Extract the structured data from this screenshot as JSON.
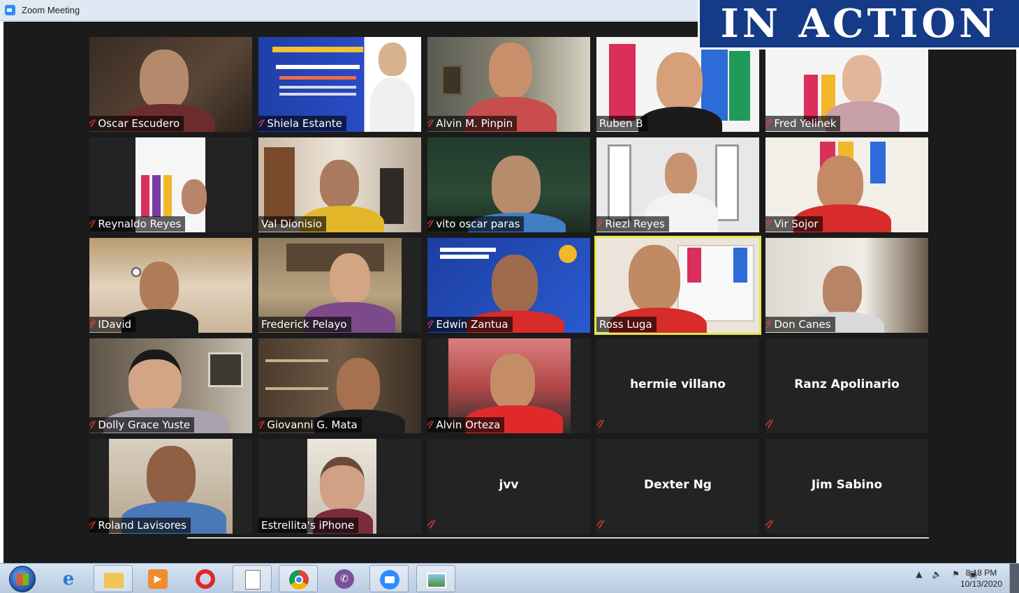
{
  "window": {
    "title": "Zoom Meeting"
  },
  "banner": {
    "text": "IN ACTION"
  },
  "participants": [
    "Oscar Escudero",
    "Shiela Estante",
    "Alvin M. Pinpin",
    "Ruben B",
    "Fred Yelinek",
    "Reynaldo Reyes",
    "Val Dionisio",
    "vito oscar paras",
    "Riezl Reyes",
    "Vir Sojor",
    "IDavid",
    "Frederick Pelayo",
    "Edwin Zantua",
    "Ross Luga",
    "Don Canes",
    "Dolly Grace Yuste",
    "Giovanni G. Mata",
    "Alvin Orteza",
    "hermie villano",
    "Ranz Apolinario",
    "Roland Lavisores",
    "Estrellita's iPhone",
    "jvv",
    "Dexter Ng",
    "Jim Sabino"
  ],
  "active_speaker": "Ross Luga",
  "taskbar": {
    "apps": [
      "start-button",
      "internet-explorer-icon",
      "file-explorer-icon",
      "media-player-icon",
      "opera-icon",
      "notepad-icon",
      "chrome-icon",
      "viber-icon",
      "zoom-icon",
      "photos-icon"
    ]
  },
  "clock": {
    "time": "8:18 PM",
    "date": "10/13/2020"
  },
  "colors": {
    "tile_bg": "#232323",
    "stage_bg": "#1b1b1b",
    "muted_mic": "#ff3b3b",
    "active_outline": "#e4e84a",
    "banner_bg": "#153a86"
  }
}
